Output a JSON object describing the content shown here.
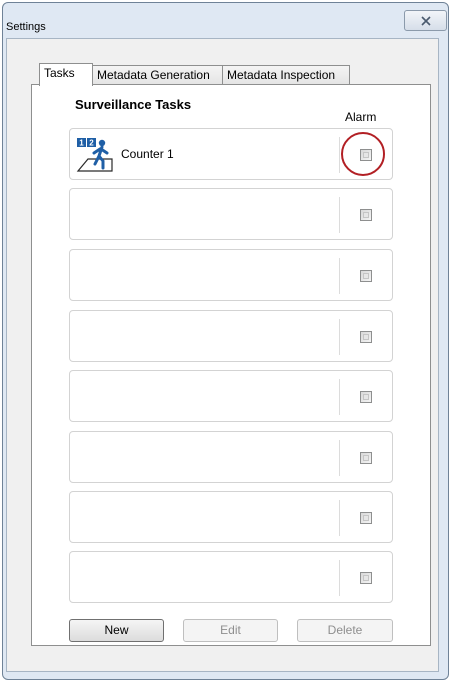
{
  "window": {
    "title": "Settings"
  },
  "tabs": [
    {
      "label": "Tasks"
    },
    {
      "label": "Metadata Generation"
    },
    {
      "label": "Metadata Inspection"
    }
  ],
  "panel": {
    "heading": "Surveillance Tasks",
    "alarm_column_label": "Alarm"
  },
  "tasks": [
    {
      "name": "Counter 1",
      "icon": "person-counter-icon",
      "alarm": false
    },
    {
      "name": "",
      "alarm": false
    },
    {
      "name": "",
      "alarm": false
    },
    {
      "name": "",
      "alarm": false
    },
    {
      "name": "",
      "alarm": false
    },
    {
      "name": "",
      "alarm": false
    },
    {
      "name": "",
      "alarm": false
    },
    {
      "name": "",
      "alarm": false
    }
  ],
  "buttons": {
    "new_label": "New",
    "edit_label": "Edit",
    "delete_label": "Delete"
  },
  "colors": {
    "highlight": "#b21f24",
    "icon_blue": "#1f5fa6"
  }
}
